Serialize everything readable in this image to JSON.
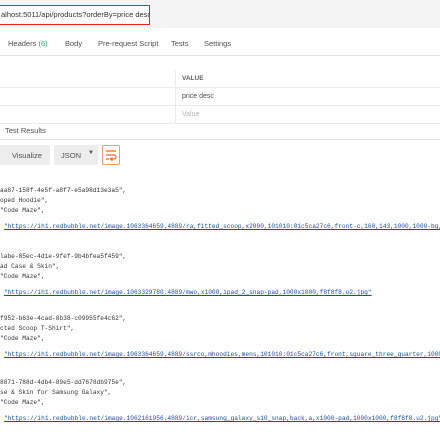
{
  "url_bar": {
    "value": "alhost:5011/api/products?orderBy=price desc"
  },
  "request_tabs": {
    "headers_label": "Headers",
    "headers_count": "(6)",
    "body_label": "Body",
    "prerequest_label": "Pre-request Script",
    "tests_label": "Tests",
    "settings_label": "Settings"
  },
  "params": {
    "value_header": "VALUE",
    "row_value": "price desc",
    "new_value_placeholder": "Value"
  },
  "test_results_label": "Test Results",
  "response_toolbar": {
    "visualize_label": "Visualize",
    "format_label": "JSON",
    "format_caret": "▼",
    "wrap_icon": "≡"
  },
  "response_items": [
    {
      "id_line": "aa87-158f-4e5f-a8f7-e5a98d13e3a5\",",
      "name_line": "oped Hoodie\",",
      "author_line": "\"Code Maze\",",
      "image_url": "\"https://ih1.redbubble.net/image.1063364659.4889/ra,fitted_scoop,x2000,101010:01c5ca27c6,front-c,160,143,1000,1000-bg,"
    },
    {
      "id_line": "labe-85ec-4d1e-9fef-9b4bfea5f459\",",
      "name_line": "ad Case & Skin\",",
      "author_line": "\"Code Maze\",",
      "image_url": "\"https://ih1.redbubble.net/image.1063329780.4889/mwo,x1000,ipad_2_snap-pad,1000x1000,f8f8f8.u2.jpg\""
    },
    {
      "id_line": "f952-b63e-4cad-8b38-c09955fe4c62\",",
      "name_line": "cted Scoop T-Shirt\",",
      "author_line": "\"Code Maze\",",
      "image_url": "\"https://ih1.redbubble.net/image.1063364659.4889/ssrco,mhoodies,mens,101010:01c5ca27c6,front,square_three_quarter,1000"
    },
    {
      "id_line": "8871-788d-4db4-89e5-dd7678db975e\",",
      "name_line": "se & Skin for Samsung Galaxy\",",
      "author_line": "\"Code Maze\",",
      "image_url": "\"https://ih1.redbubble.net/image.1062161956.4889/icr,samsung_galaxy_s10_snap,back,a,x1000-pad,1000x1000,f8f8f8.u2.jpg\""
    }
  ],
  "colors": {
    "url_border": "#e0261b",
    "accent_orange": "#f26b3a",
    "count_green": "#26a862",
    "link_blue": "#1a4fa0"
  }
}
